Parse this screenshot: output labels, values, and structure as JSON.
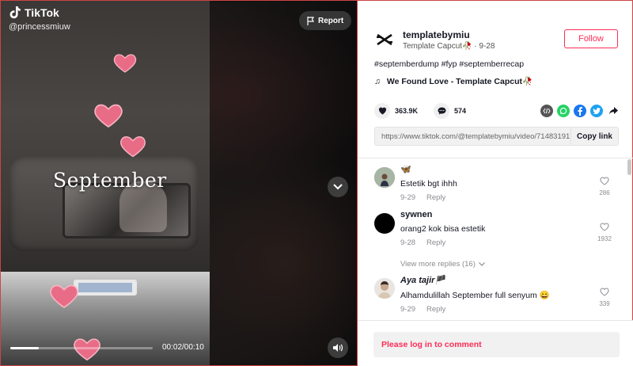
{
  "brand": {
    "name": "TikTok",
    "handle": "@princessmiuw"
  },
  "player": {
    "report_label": "Report",
    "overlay_text": "September",
    "time": "00:02/00:10",
    "progress": 0.2
  },
  "author": {
    "name": "templatebymiu",
    "sub": "Template Capcut🥀 · 9-28",
    "follow_label": "Follow"
  },
  "caption": "#septemberdump #fyp #septemberrecap",
  "music": "We Found Love - Template Capcut🥀",
  "stats": {
    "likes": "363.9K",
    "comments": "574"
  },
  "link": {
    "url": "https://www.tiktok.com/@templatebymiu/video/7148319179...",
    "copy_label": "Copy link"
  },
  "comments": [
    {
      "name": "🦋",
      "text": "Estetik bgt ihhh",
      "date": "9-29",
      "reply": "Reply",
      "likes": "286"
    },
    {
      "name": "sywnen",
      "text": "orang2 kok bisa estetik",
      "date": "9-28",
      "reply": "Reply",
      "likes": "1932"
    },
    {
      "name": "Aya tajir🏴",
      "text": "Alhamdulillah September full senyum 😄",
      "date": "9-29",
      "reply": "Reply",
      "likes": "339"
    }
  ],
  "view_more": "View more replies (16)",
  "login_prompt": "Please log in to comment",
  "colors": {
    "accent": "#fe2c55",
    "player_bg": "#111111"
  },
  "icons": [
    "tiktok-logo-icon",
    "flag-icon",
    "chevron-down-icon",
    "volume-icon",
    "heart-icon",
    "comment-icon",
    "embed-icon",
    "whatsapp-icon",
    "facebook-icon",
    "twitter-icon",
    "share-arrow-icon",
    "music-note-icon",
    "capcut-icon"
  ]
}
